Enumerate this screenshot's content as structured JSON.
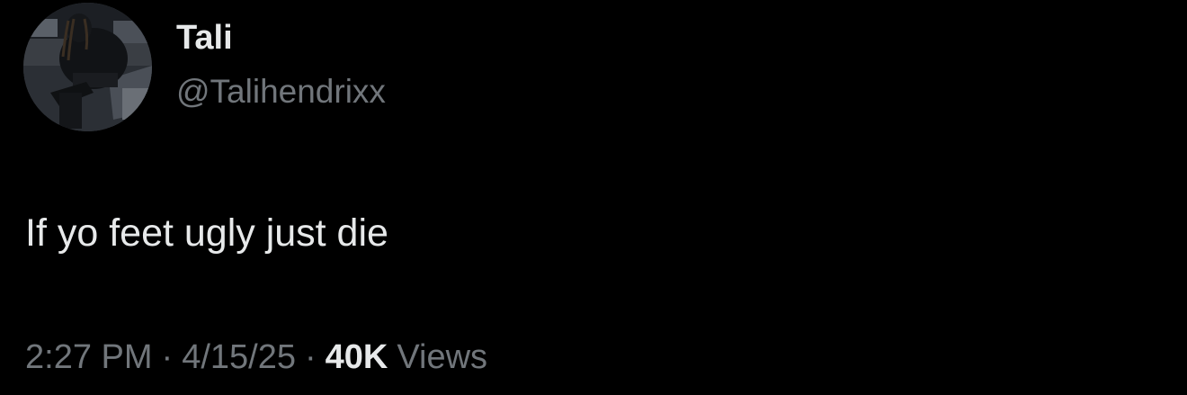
{
  "tweet": {
    "author": {
      "display_name": "Tali",
      "handle": "@Talihendrixx",
      "avatar_icon": "profile-photo"
    },
    "text": "If yo feet ugly just die",
    "time": "2:27 PM",
    "separator": "·",
    "date": "4/15/25",
    "views_count": "40K",
    "views_label": "Views"
  },
  "colors": {
    "background": "#000000",
    "primary_text": "#e7e9ea",
    "secondary_text": "#71767b"
  }
}
